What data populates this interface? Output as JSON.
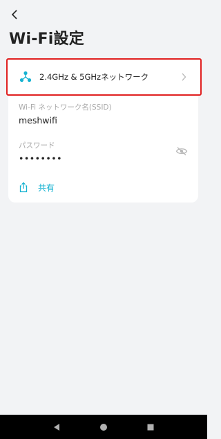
{
  "header": {
    "title": "Wi-Fi設定",
    "back_icon": "chevron-left-icon"
  },
  "band_row": {
    "icon": "mesh-network-icon",
    "label": "2.4GHz & 5GHzネットワーク",
    "chevron_icon": "chevron-right-icon",
    "accent_color": "#16b2d1",
    "highlight_color": "#e02020"
  },
  "network": {
    "ssid_label": "Wi-Fi ネットワーク名(SSID)",
    "ssid_value": "meshwifi",
    "password_label": "パスワード",
    "password_value": "••••••••",
    "visibility_icon": "eye-off-icon"
  },
  "share": {
    "icon": "share-icon",
    "label": "共有"
  },
  "system_nav": {
    "back": "nav-back-icon",
    "home": "nav-home-icon",
    "recents": "nav-recents-icon"
  }
}
